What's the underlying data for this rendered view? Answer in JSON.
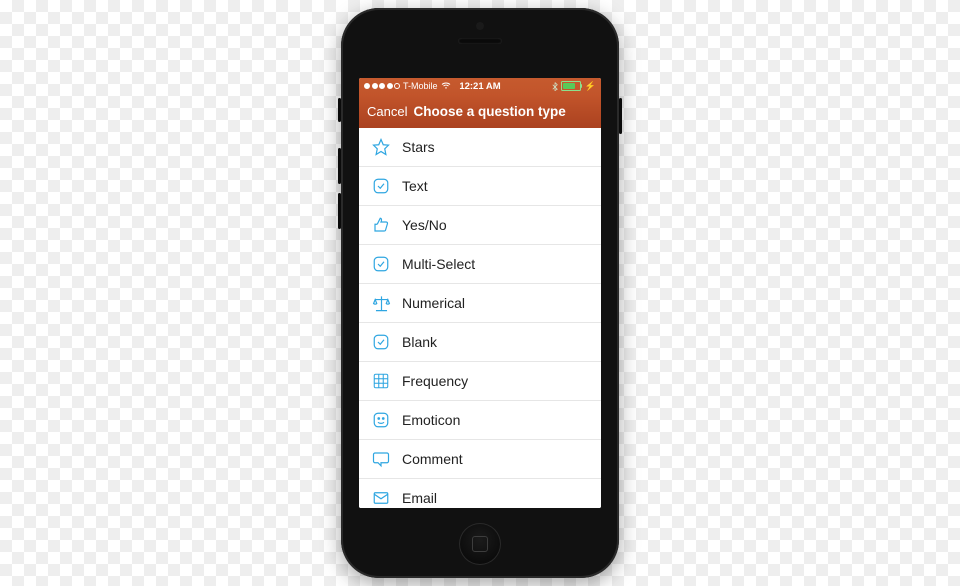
{
  "statusBar": {
    "carrier": "T-Mobile",
    "time": "12:21 AM"
  },
  "navBar": {
    "cancel": "Cancel",
    "title": "Choose a question type"
  },
  "questionTypes": [
    {
      "label": "Stars"
    },
    {
      "label": "Text"
    },
    {
      "label": "Yes/No"
    },
    {
      "label": "Multi-Select"
    },
    {
      "label": "Numerical"
    },
    {
      "label": "Blank"
    },
    {
      "label": "Frequency"
    },
    {
      "label": "Emoticon"
    },
    {
      "label": "Comment"
    },
    {
      "label": "Email"
    }
  ]
}
